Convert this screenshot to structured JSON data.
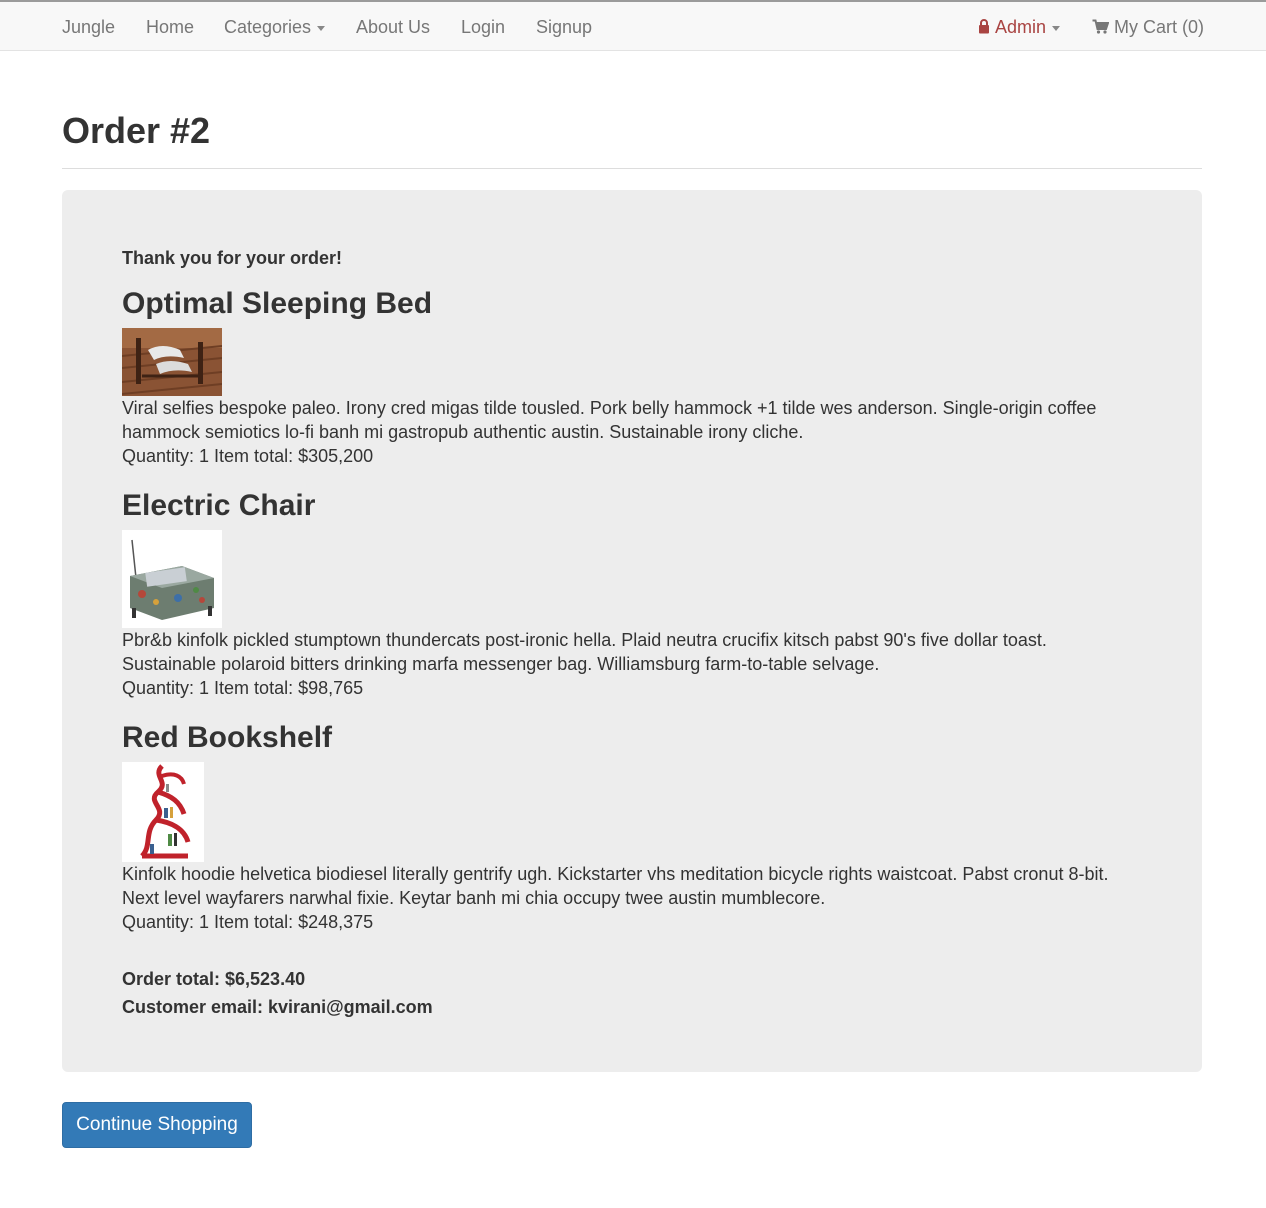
{
  "nav": {
    "brand": "Jungle",
    "home": "Home",
    "categories": "Categories",
    "about": "About Us",
    "login": "Login",
    "signup": "Signup",
    "admin": "Admin",
    "cart": "My Cart (0)"
  },
  "page": {
    "title": "Order #2"
  },
  "order": {
    "thanks": "Thank you for your order!",
    "items": [
      {
        "name": "Optimal Sleeping Bed",
        "description": "Viral selfies bespoke paleo. Irony cred migas tilde tousled. Pork belly hammock +1 tilde wes anderson. Single-origin coffee hammock semiotics lo-fi banh mi gastropub authentic austin. Sustainable irony cliche.",
        "quantity_line": "Quantity: 1 Item total: $305,200"
      },
      {
        "name": "Electric Chair",
        "description": "Pbr&b kinfolk pickled stumptown thundercats post-ironic hella. Plaid neutra crucifix kitsch pabst 90's five dollar toast. Sustainable polaroid bitters drinking marfa messenger bag. Williamsburg farm-to-table selvage.",
        "quantity_line": "Quantity: 1 Item total: $98,765"
      },
      {
        "name": "Red Bookshelf",
        "description": "Kinfolk hoodie helvetica biodiesel literally gentrify ugh. Kickstarter vhs meditation bicycle rights waistcoat. Pabst cronut 8-bit. Next level wayfarers narwhal fixie. Keytar banh mi chia occupy twee austin mumblecore.",
        "quantity_line": "Quantity: 1 Item total: $248,375"
      }
    ],
    "total": "Order total: $6,523.40",
    "email": "Customer email: kvirani@gmail.com"
  },
  "actions": {
    "continue": "Continue Shopping"
  },
  "colors": {
    "navbar_bg": "#f8f8f8",
    "panel_bg": "#ededed",
    "primary": "#337ab7",
    "admin": "#a94442"
  }
}
